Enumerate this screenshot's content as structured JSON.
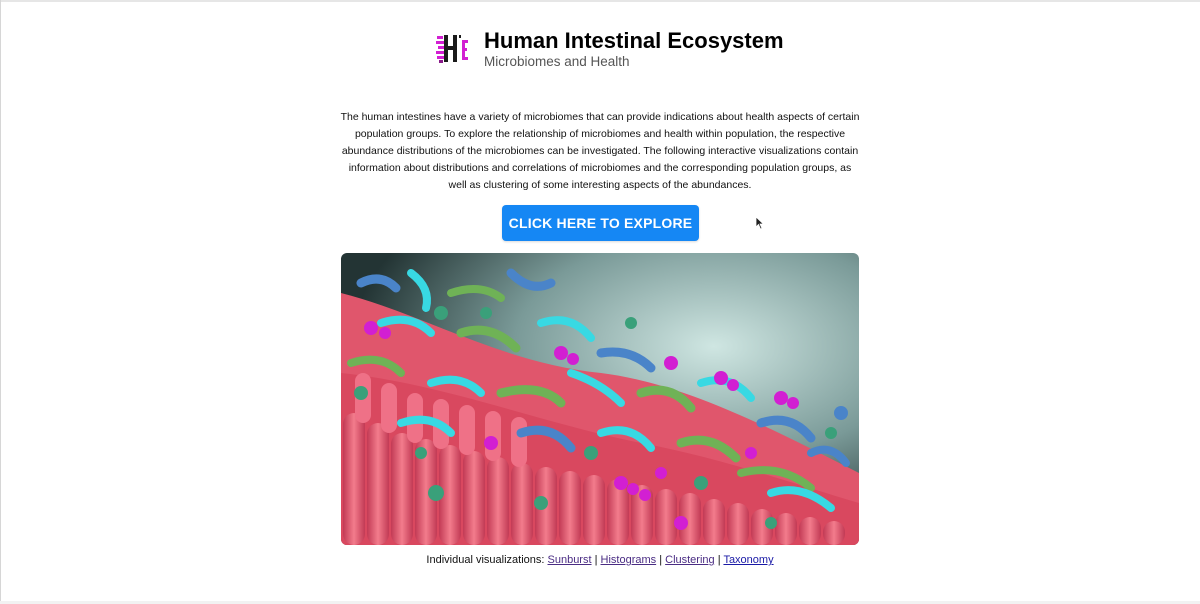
{
  "header": {
    "title": "Human Intestinal Ecosystem",
    "subtitle": "Microbiomes and Health",
    "logo_icon": "hie-logo-icon"
  },
  "intro": {
    "text": "The human intestines have a variety of microbiomes that can provide indications about health aspects of certain population groups. To explore the relationship of microbiomes and health within population, the respective abundance distributions of the microbiomes can be investigated. The following interactive visualizations contain information about distributions and correlations of microbiomes and the corresponding population groups, as well as clustering of some interesting aspects of the abundances."
  },
  "cta": {
    "label": "CLICK HERE TO EXPLORE",
    "color": "#1587f4"
  },
  "footer": {
    "prefix": "Individual visualizations:",
    "separator": "|",
    "links": [
      {
        "label": "Sunburst"
      },
      {
        "label": "Histograms"
      },
      {
        "label": "Clustering"
      },
      {
        "label": "Taxonomy"
      }
    ]
  },
  "colors": {
    "logo_magenta": "#d21fd2",
    "tissue_pink": "#e8566a",
    "bacteria_cyan": "#38d9e3",
    "bacteria_blue": "#4a84c9",
    "bacteria_green": "#6fb256"
  }
}
